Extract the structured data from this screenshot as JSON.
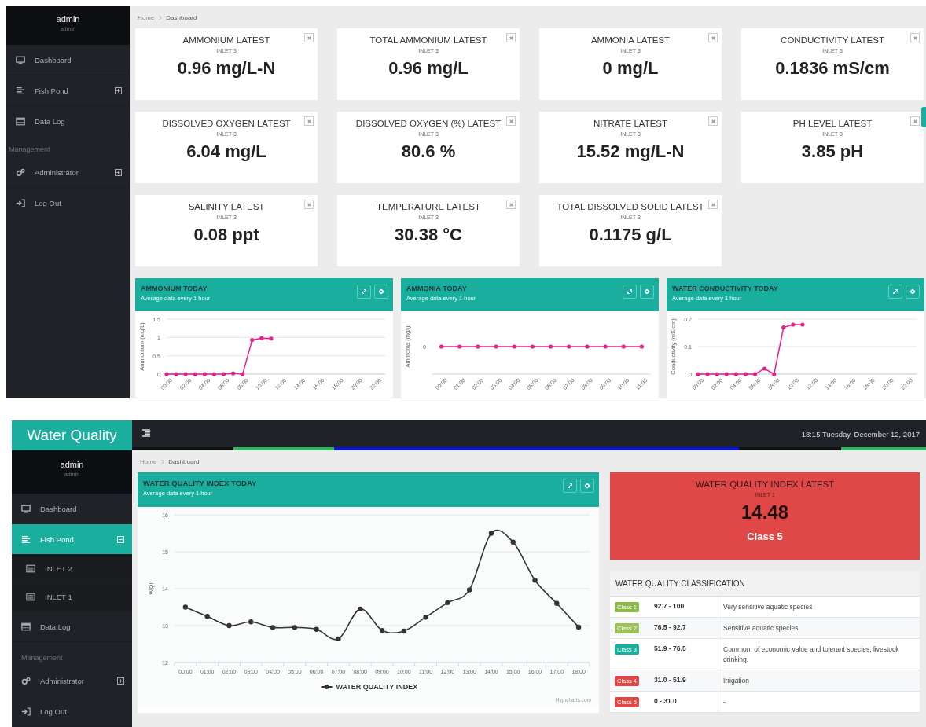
{
  "dashboard_top": {
    "sidebar": {
      "user": {
        "name": "admin",
        "role": "admin"
      },
      "items": [
        {
          "kind": "link",
          "label": "Dashboard",
          "selected": false
        },
        {
          "kind": "link",
          "label": "Fish Pond",
          "selected": false,
          "expanded": false
        },
        {
          "kind": "link",
          "label": "Data Log",
          "selected": false
        },
        {
          "kind": "heading",
          "label": "Management"
        },
        {
          "kind": "link",
          "label": "Administrator",
          "selected": false,
          "expanded": false
        },
        {
          "kind": "link",
          "label": "Log Out",
          "selected": false
        }
      ]
    },
    "breadcrumb": [
      "Home",
      "Dashboard"
    ],
    "stat_cards": [
      {
        "title": "AMMONIUM LATEST",
        "location": "INLET 3",
        "value": "0.96 mg/L-N"
      },
      {
        "title": "TOTAL AMMONIUM LATEST",
        "location": "INLET 3",
        "value": "0.96 mg/L"
      },
      {
        "title": "AMMONIA LATEST",
        "location": "INLET 3",
        "value": "0 mg/L"
      },
      {
        "title": "CONDUCTIVITY LATEST",
        "location": "INLET 3",
        "value": "0.1836 mS/cm"
      },
      {
        "title": "DISSOLVED OXYGEN LATEST",
        "location": "INLET 3",
        "value": "6.04 mg/L"
      },
      {
        "title": "DISSOLVED OXYGEN (%) LATEST",
        "location": "INLET 3",
        "value": "80.6 %"
      },
      {
        "title": "NITRATE LATEST",
        "location": "INLET 3",
        "value": "15.52 mg/L-N"
      },
      {
        "title": "PH LEVEL LATEST",
        "location": "INLET 3",
        "value": "3.85 pH"
      },
      {
        "title": "SALINITY LATEST",
        "location": "INLET 3",
        "value": "0.08 ppt"
      },
      {
        "title": "TEMPERATURE LATEST",
        "location": "INLET 3",
        "value": "30.38 °C"
      },
      {
        "title": "TOTAL DISSOLVED SOLID LATEST",
        "location": "INLET 3",
        "value": "0.1175 g/L"
      }
    ],
    "chart_cards": [
      {
        "title": "AMMONIUM TODAY",
        "subtitle": "Average data every 1 hour",
        "chart_data": {
          "type": "line",
          "ylabel": "Ammonium (mg/L)",
          "x": [
            0,
            1,
            2,
            3,
            4,
            5,
            6,
            7,
            8,
            9,
            10,
            11
          ],
          "xlim": [
            0,
            23
          ],
          "xticks": [
            {
              "value": 0,
              "label": "00:00"
            },
            {
              "value": 2,
              "label": "02:00"
            },
            {
              "value": 4,
              "label": "04:00"
            },
            {
              "value": 6,
              "label": "06:00"
            },
            {
              "value": 8,
              "label": "08:00"
            },
            {
              "value": 10,
              "label": "10:00"
            },
            {
              "value": 12,
              "label": "12:00"
            },
            {
              "value": 14,
              "label": "14:00"
            },
            {
              "value": 16,
              "label": "16:00"
            },
            {
              "value": 18,
              "label": "18:00"
            },
            {
              "value": 20,
              "label": "20:00"
            },
            {
              "value": 22,
              "label": "22:00"
            }
          ],
          "ylim": [
            0,
            1.5
          ],
          "yticks": [
            0,
            0.5,
            1,
            1.5
          ],
          "grid": true,
          "series": [
            {
              "color": "#e91e8c",
              "marker": true,
              "values": [
                0,
                0,
                0,
                0,
                0,
                0,
                0,
                0.02,
                0,
                0.93,
                0.98,
                0.97
              ]
            }
          ]
        }
      },
      {
        "title": "AMMONIA TODAY",
        "subtitle": "Average data every 1 hour",
        "chart_picture": {
          "axis_title": "Ammonia (mg/l)",
          "axis_value": "0",
          "x_labels": [
            "00:00",
            "01:00",
            "02:00",
            "03:00",
            "04:00",
            "05:00",
            "06:00",
            "07:00",
            "08:00",
            "09:00",
            "10:00",
            "11:00"
          ]
        }
      },
      {
        "title": "WATER CONDUCTIVITY TODAY",
        "subtitle": "Average data every 1 hour",
        "chart_data": {
          "type": "line",
          "ylabel": "Conductivity (mS/cm)",
          "x": [
            0,
            1,
            2,
            3,
            4,
            5,
            6,
            7,
            8,
            9,
            10,
            11
          ],
          "xlim": [
            0,
            23
          ],
          "xticks": [
            {
              "value": 0,
              "label": "00:00"
            },
            {
              "value": 2,
              "label": "02:00"
            },
            {
              "value": 4,
              "label": "04:00"
            },
            {
              "value": 6,
              "label": "06:00"
            },
            {
              "value": 8,
              "label": "08:00"
            },
            {
              "value": 10,
              "label": "10:00"
            },
            {
              "value": 12,
              "label": "12:00"
            },
            {
              "value": 14,
              "label": "14:00"
            },
            {
              "value": 16,
              "label": "16:00"
            },
            {
              "value": 18,
              "label": "18:00"
            },
            {
              "value": 20,
              "label": "20:00"
            },
            {
              "value": 22,
              "label": "22:00"
            }
          ],
          "ylim": [
            0,
            0.2
          ],
          "yticks": [
            0,
            0.1,
            0.2
          ],
          "grid": true,
          "series": [
            {
              "color": "#e91e8c",
              "marker": true,
              "values": [
                0,
                0,
                0,
                0,
                0,
                0,
                0,
                0.02,
                0,
                0.17,
                0.18,
                0.18
              ]
            }
          ]
        }
      }
    ]
  },
  "dashboard_bottom": {
    "app_title": "Water Quality",
    "datetime": "18:15 Tuesday, December 12, 2017",
    "sidebar": {
      "user": {
        "name": "admin",
        "role": "admin"
      },
      "items": [
        {
          "kind": "link",
          "label": "Dashboard",
          "selected": false
        },
        {
          "kind": "link",
          "label": "Fish Pond",
          "selected": true,
          "expanded": true,
          "children": [
            {
              "label": "INLET 2",
              "selected": false
            },
            {
              "label": "INLET 1",
              "selected": false
            }
          ]
        },
        {
          "kind": "link",
          "label": "Data Log",
          "selected": false
        },
        {
          "kind": "heading",
          "label": "Management"
        },
        {
          "kind": "link",
          "label": "Administrator",
          "selected": false,
          "expanded": false
        },
        {
          "kind": "link",
          "label": "Log Out",
          "selected": false
        }
      ]
    },
    "breadcrumb": [
      "Home",
      "Dashboard"
    ],
    "wqi_chart": {
      "title": "WATER QUALITY INDEX TODAY",
      "subtitle": "Average data every 1 hour",
      "credit": "Highcharts.com",
      "chart_data": {
        "type": "line",
        "ylabel": "WQI",
        "categories": [
          "00:00",
          "01:00",
          "02:00",
          "03:00",
          "04:00",
          "05:00",
          "06:00",
          "07:00",
          "08:00",
          "09:00",
          "10:00",
          "11:00",
          "12:00",
          "13:00",
          "14:00",
          "15:00",
          "16:00",
          "17:00",
          "18:00"
        ],
        "ylim": [
          12,
          16
        ],
        "yticks": [
          12,
          13,
          14,
          15,
          16
        ],
        "grid": true,
        "series": [
          {
            "name": "WATER QUALITY INDEX",
            "color": "#333333",
            "marker": true,
            "values": [
              13.5,
              13.25,
              13.0,
              13.1,
              12.95,
              12.95,
              12.9,
              12.64,
              13.45,
              12.87,
              12.85,
              13.23,
              13.62,
              13.97,
              15.5,
              15.26,
              14.23,
              13.6,
              12.96
            ]
          }
        ]
      }
    },
    "wqi_latest": {
      "title": "WATER QUALITY INDEX LATEST",
      "location": "INLET 1",
      "value": "14.48",
      "class_label": "Class 5"
    },
    "classification": {
      "title": "WATER QUALITY CLASSIFICATION",
      "rows": [
        {
          "badge": "Class 1",
          "color": "#8db94b",
          "range": "92.7 - 100",
          "description": "Very sensitive aquatic species"
        },
        {
          "badge": "Class 2",
          "color": "#9cc257",
          "range": "76.5 - 92.7",
          "description": "Sensitive aquatic species"
        },
        {
          "badge": "Class 3",
          "color": "#1aae9f",
          "range": "51.9 - 76.5",
          "description": "Common, of economic value and tolerant species; livestock drinking."
        },
        {
          "badge": "Class 4",
          "color": "#e04848",
          "range": "31.0 - 51.9",
          "description": "Irrigation"
        },
        {
          "badge": "Class 5",
          "color": "#e04848",
          "range": "0 - 31.0",
          "description": "-"
        }
      ]
    }
  }
}
